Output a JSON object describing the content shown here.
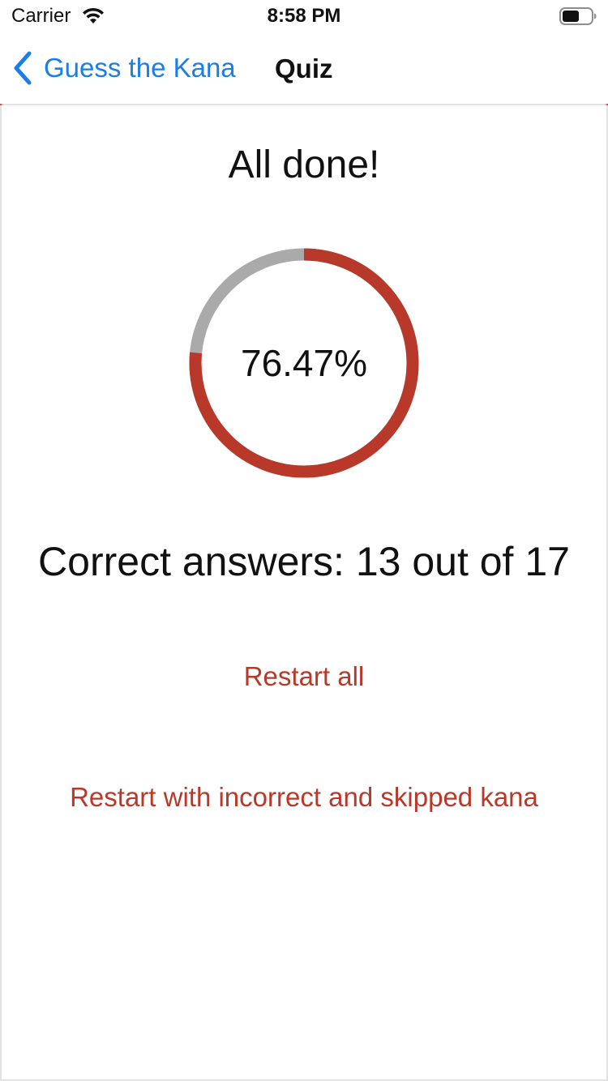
{
  "status_bar": {
    "carrier": "Carrier",
    "time": "8:58 PM"
  },
  "nav": {
    "back_label": "Guess the Kana",
    "title": "Quiz"
  },
  "result": {
    "heading": "All done!",
    "percentage_text": "76.47%",
    "correct_fraction": 0.7647,
    "score_text": "Correct answers: 13 out of 17"
  },
  "actions": {
    "restart_all": "Restart all",
    "restart_incorrect": "Restart with incorrect and skipped kana"
  },
  "colors": {
    "accent": "#b8392a",
    "ring_track": "#aaaaaa",
    "link_blue": "#1a7ee8"
  },
  "icons": {
    "wifi": "wifi-icon",
    "battery": "battery-icon",
    "back": "chevron-left-icon"
  }
}
